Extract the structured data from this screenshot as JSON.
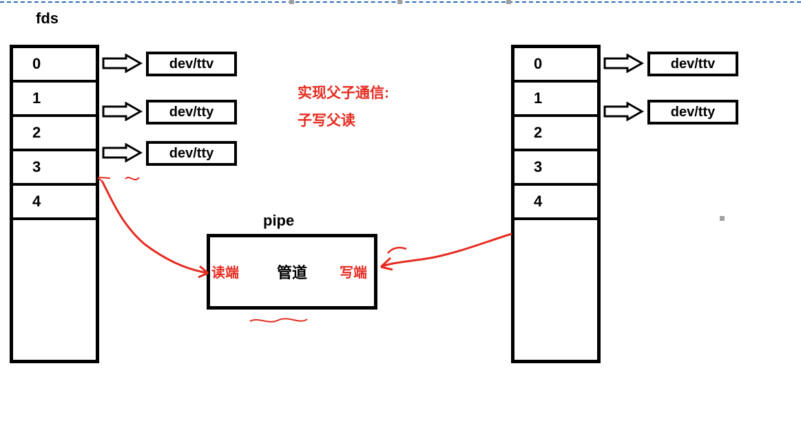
{
  "fds_label": "fds",
  "left_table": {
    "cells": [
      "0",
      "1",
      "2",
      "3",
      "4"
    ]
  },
  "right_table": {
    "cells": [
      "0",
      "1",
      "2",
      "3",
      "4"
    ]
  },
  "left_dev_boxes": [
    "dev/ttv",
    "dev/tty",
    "dev/tty"
  ],
  "right_dev_boxes": [
    "dev/ttv",
    "dev/tty"
  ],
  "message": {
    "line1": "实现父子通信:",
    "line2": "子写父读"
  },
  "pipe": {
    "label": "pipe",
    "content": "管道",
    "read_end": "读端",
    "write_end": "写端"
  },
  "colors": {
    "red": "#e52b20",
    "border": "#000000",
    "dashed": "#2a6abf"
  }
}
